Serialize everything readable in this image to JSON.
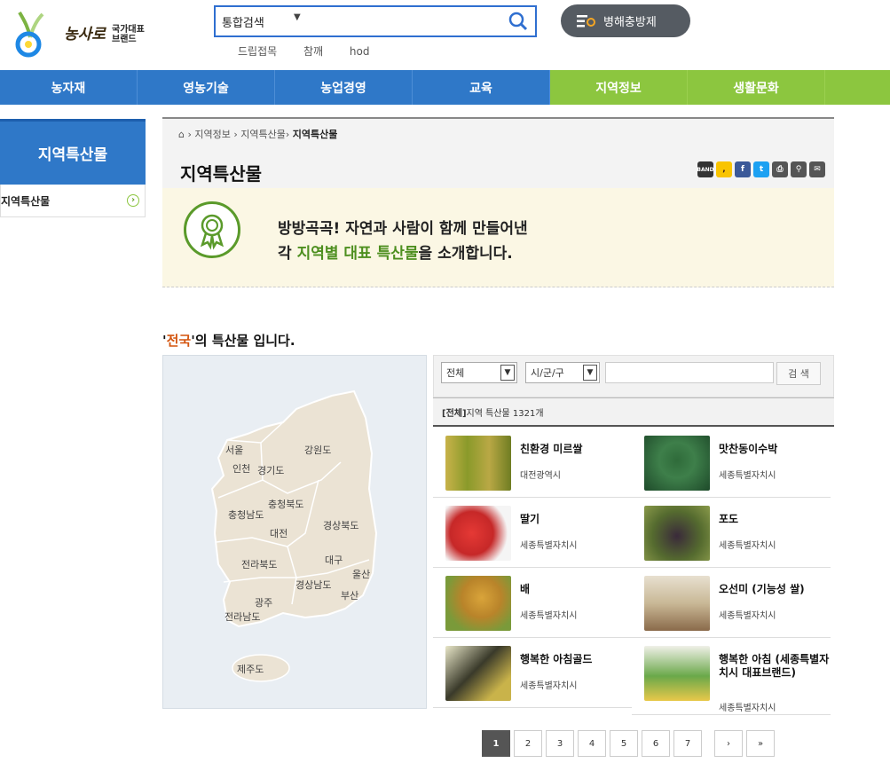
{
  "header": {
    "logo_text": "농사로",
    "logo_badge": "국가대표 브랜드",
    "search_category": "통합검색",
    "keywords": [
      "드립접목",
      "참깨",
      "hod"
    ],
    "pest_button": "병해충방제"
  },
  "gnb": [
    "농자재",
    "영농기술",
    "농업경영",
    "교육",
    "지역정보",
    "생활문화"
  ],
  "gnb_active": "지역정보",
  "lnb": {
    "title": "지역특산물",
    "items": [
      {
        "label": "지역특산물"
      }
    ]
  },
  "content": {
    "breadcrumb": [
      "지역정보",
      "지역특산물"
    ],
    "breadcrumb_current": "지역특산물",
    "title": "지역특산물",
    "share": [
      "BAND",
      "카카오",
      "f",
      "t",
      "인쇄",
      "링크",
      "메일"
    ],
    "intro_line1": "방방곡곡! 자연과 사람이 함께 만들어낸",
    "intro_line2_pre": "각 ",
    "intro_line2_hl": "지역별 대표 특산물",
    "intro_line2_post": "을 소개합니다.",
    "region_prefix": "'",
    "region_name": "전국",
    "region_suffix": "'의 특산물 입니다."
  },
  "map": {
    "labels": [
      "서울",
      "강원도",
      "인천",
      "경기도",
      "충청북도",
      "충청남도",
      "경상북도",
      "대전",
      "전라북도",
      "대구",
      "울산",
      "경상남도",
      "부산",
      "광주",
      "전라남도",
      "제주도"
    ]
  },
  "filter": {
    "province": "전체",
    "city": "시/군/구",
    "keyword": "",
    "search_button": "검 색"
  },
  "total": {
    "label": "[전체]",
    "text": " 지역 특산물 1321개"
  },
  "products": [
    {
      "name": "친환경 미르쌀",
      "region": "대전광역시"
    },
    {
      "name": "맛찬동이수박",
      "region": "세종특별자치시"
    },
    {
      "name": "딸기",
      "region": "세종특별자치시"
    },
    {
      "name": "포도",
      "region": "세종특별자치시"
    },
    {
      "name": "배",
      "region": "세종특별자치시"
    },
    {
      "name": "오선미 (기능성 쌀)",
      "region": "세종특별자치시"
    },
    {
      "name": "행복한 아침골드",
      "region": "세종특별자치시"
    },
    {
      "name": "행복한 아침 (세종특별자치시 대표브랜드)",
      "region": "세종특별자치시"
    }
  ],
  "pagination": {
    "pages": [
      "1",
      "2",
      "3",
      "4",
      "5",
      "6",
      "7"
    ],
    "current": "1",
    "next": "›",
    "last": "»"
  },
  "colors": {
    "primary_blue": "#2f78c8",
    "active_green": "#8cc63f",
    "highlight_green": "#4d8f1f",
    "highlight_orange": "#d4550f"
  }
}
